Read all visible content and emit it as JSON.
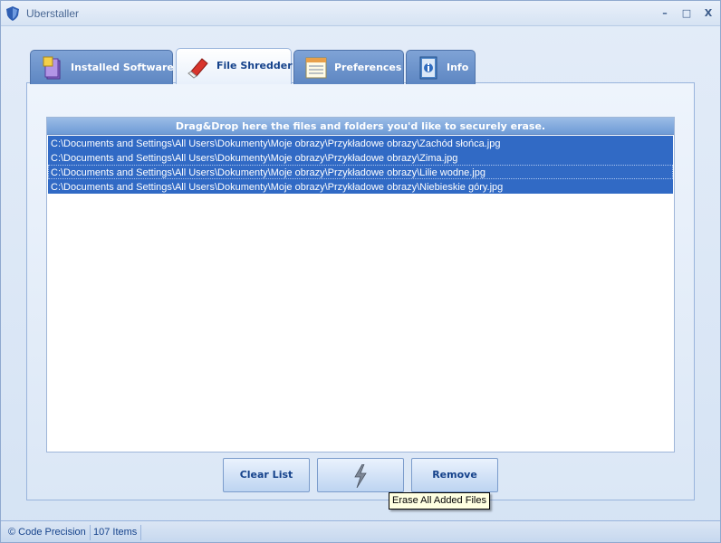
{
  "window": {
    "title": "Uberstaller"
  },
  "controls": {
    "minimize": "–",
    "maximize": "□",
    "close": "X"
  },
  "tabs": [
    {
      "label": "Installed Software",
      "icon": "software-box-icon",
      "active": false
    },
    {
      "label": "File Shredder",
      "icon": "eraser-icon",
      "active": true
    },
    {
      "label": "Preferences",
      "icon": "preferences-list-icon",
      "active": false
    },
    {
      "label": "Info",
      "icon": "info-book-icon",
      "active": false
    }
  ],
  "shredder": {
    "header": "Drag&Drop here the files and folders you'd like to securely erase.",
    "files": [
      "C:\\Documents and Settings\\All Users\\Dokumenty\\Moje obrazy\\Przykładowe obrazy\\Zachód słońca.jpg",
      "C:\\Documents and Settings\\All Users\\Dokumenty\\Moje obrazy\\Przykładowe obrazy\\Zima.jpg",
      "C:\\Documents and Settings\\All Users\\Dokumenty\\Moje obrazy\\Przykładowe obrazy\\Lilie wodne.jpg",
      "C:\\Documents and Settings\\All Users\\Dokumenty\\Moje obrazy\\Przykładowe obrazy\\Niebieskie góry.jpg"
    ],
    "clear_label": "Clear List",
    "erase_icon": "lightning-bolt-icon",
    "remove_label": "Remove",
    "tooltip": "Erase All Added Files"
  },
  "status": {
    "copyright": "© Code Precision",
    "count": "107 Items"
  },
  "colors": {
    "selection": "#316ac5",
    "header": "#6e9bd6",
    "tab_inactive": "#5d86c2",
    "text": "#15428b"
  }
}
